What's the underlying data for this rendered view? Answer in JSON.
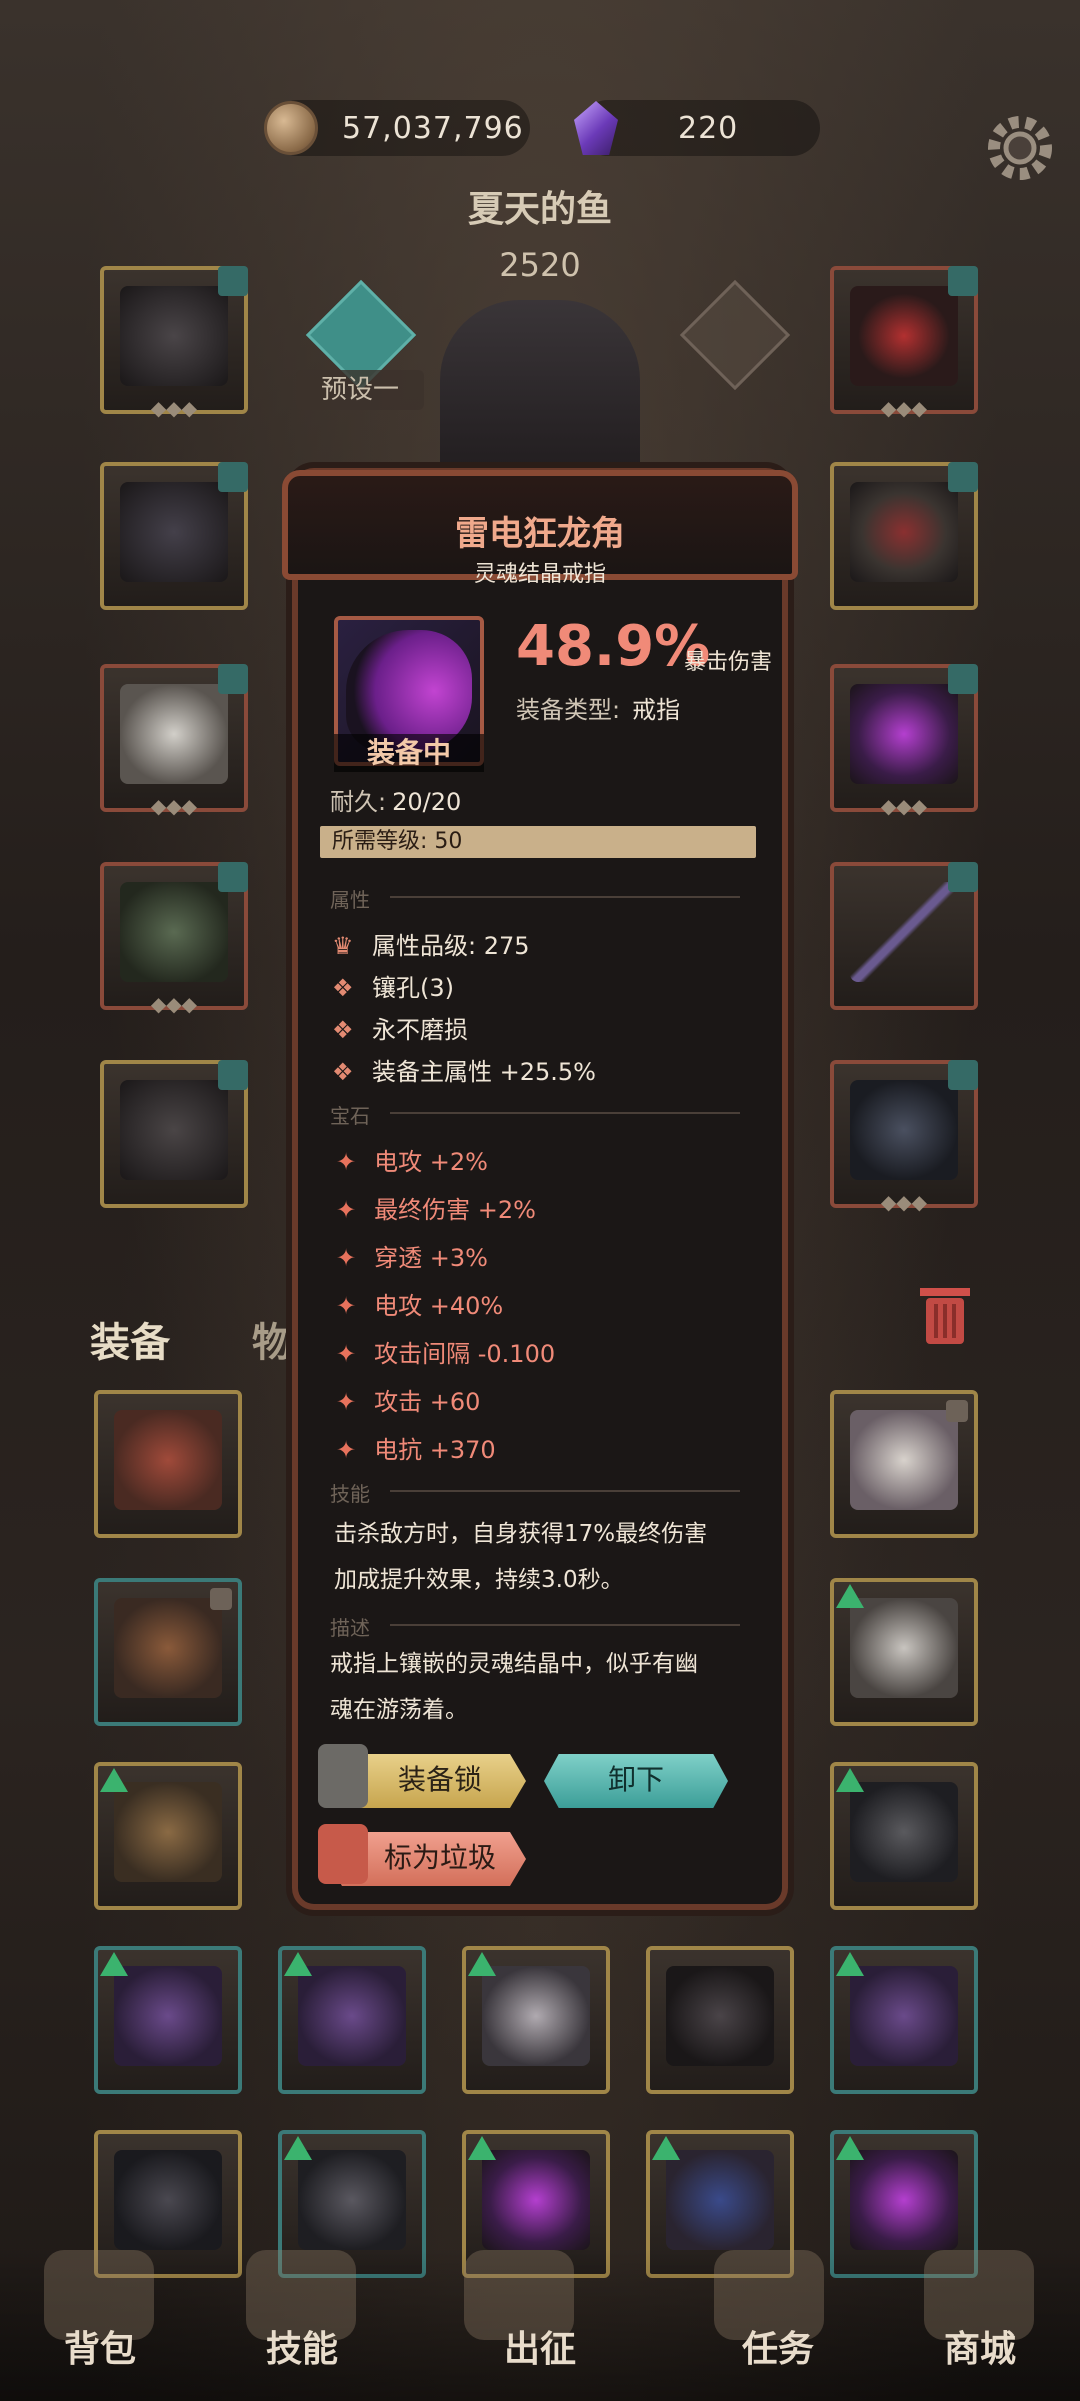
{
  "header": {
    "gold": "57,037,796",
    "gems": "220",
    "player_name": "夏天的鱼",
    "power": "2520",
    "preset_label": "预设一"
  },
  "tabs": {
    "equip": "装备",
    "items": "物品"
  },
  "popup": {
    "title": "雷电狂龙角",
    "subtitle": "灵魂结晶戒指",
    "equipped_label": "装备中",
    "crit_value": "48.9%",
    "crit_label": "暴击伤害",
    "type_label": "装备类型:",
    "type_value": "戒指",
    "durability_label": "耐久:",
    "durability_value": "20/20",
    "level_req": "所需等级: 50",
    "section_attr": "属性",
    "attr_rows": [
      "属性品级: 275",
      "镶孔(3)",
      "永不磨损",
      "装备主属性 +25.5%"
    ],
    "section_gem": "宝石",
    "gem_rows": [
      "电攻 +2%",
      "最终伤害 +2%",
      "穿透 +3%",
      "电攻 +40%",
      "攻击间隔 -0.100",
      "攻击 +60",
      "电抗 +370"
    ],
    "section_skill": "技能",
    "skill_text_1": "击杀敌方时，自身获得17%最终伤害",
    "skill_text_2": "加成提升效果，持续3.0秒。",
    "section_desc": "描述",
    "desc_text_1": "戒指上镶嵌的灵魂结晶中，似乎有幽",
    "desc_text_2": "魂在游荡着。",
    "btn_lock": "装备锁",
    "btn_unequip": "卸下",
    "btn_junk": "标为垃圾"
  },
  "nav": {
    "bag": "背包",
    "skills": "技能",
    "expedition": "出征",
    "quests": "任务",
    "shop": "商城"
  },
  "colors": {
    "accent_red": "#f08a78",
    "accent_teal": "#3c9e98",
    "gold_btn": "#c7a54e"
  },
  "icons": {
    "gold": "coin-icon",
    "gems": "purple-gem-icon",
    "settings": "gear-icon",
    "trash": "trash-icon"
  }
}
